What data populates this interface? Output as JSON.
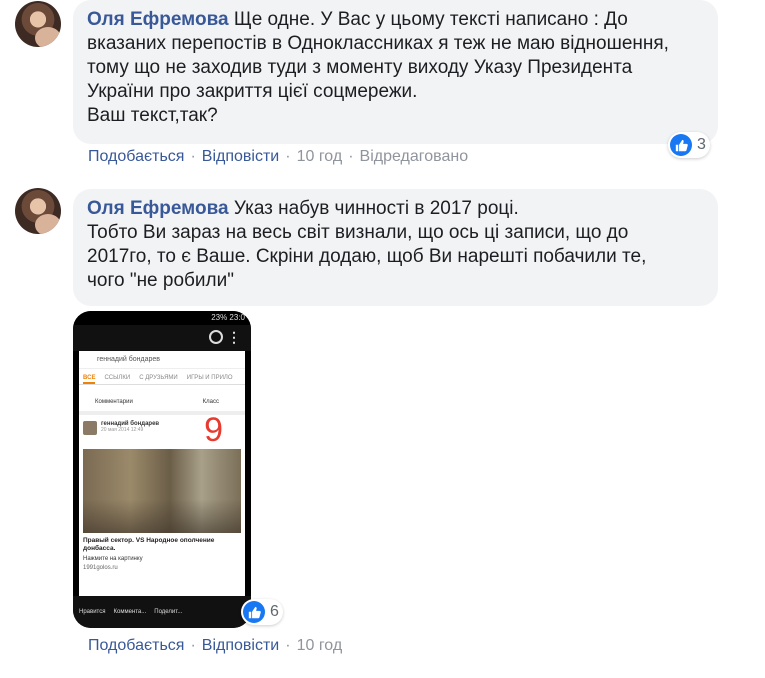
{
  "comments": [
    {
      "author": "Оля Ефремова",
      "text": "Ще одне. У Вас у цьому тексті написано : До\nвказаних перепостів в Одноклассниках я теж не маю відношення,\nтому що не заходив туди з моменту виходу Указу Президента\nУкраїни про закриття цієї соцмережи.\nВаш текст,так?",
      "actions": {
        "like": "Подобається",
        "reply": "Відповісти",
        "time": "10 год",
        "edited": "Відредаговано"
      },
      "reactions": {
        "icon": "like-icon",
        "count": "3"
      }
    },
    {
      "author": "Оля Ефремова",
      "text": "Указ набув чинності в 2017 році.\nТобто Ви зараз на весь світ визнали, що ось ці записи, що до\n2017го, то є Ваше. Скріни додаю, щоб Ви нарешті побачили те,\nчого \"не робили\"",
      "actions": {
        "like": "Подобається",
        "reply": "Відповісти",
        "time": "10 год"
      },
      "reactions": {
        "icon": "like-icon",
        "count": "6"
      },
      "attachment": {
        "status": "23%  23:0",
        "query": "геннадий бондарев",
        "tabs": [
          "ВСЕ",
          "ССЫЛКИ",
          "С ДРУЗЬЯМИ",
          "ИГРЫ И ПРИЛО"
        ],
        "bar_left": "Комментарии",
        "bar_right": "Класс",
        "post_author": "геннадий бондарев",
        "post_date": "20 мая 2014 12:49",
        "annotation": "9",
        "caption": "Правый сектор. VS Народное ополчение донбасса.",
        "link_text": "Нажмите на картинку",
        "source": "1991golos.ru",
        "footer": [
          "Нравится",
          "Коммента...",
          "Поделит..."
        ]
      }
    }
  ],
  "colors": {
    "link": "#385898",
    "bubble": "#f2f3f5",
    "meta": "#90949c",
    "like": "#1877f2"
  }
}
